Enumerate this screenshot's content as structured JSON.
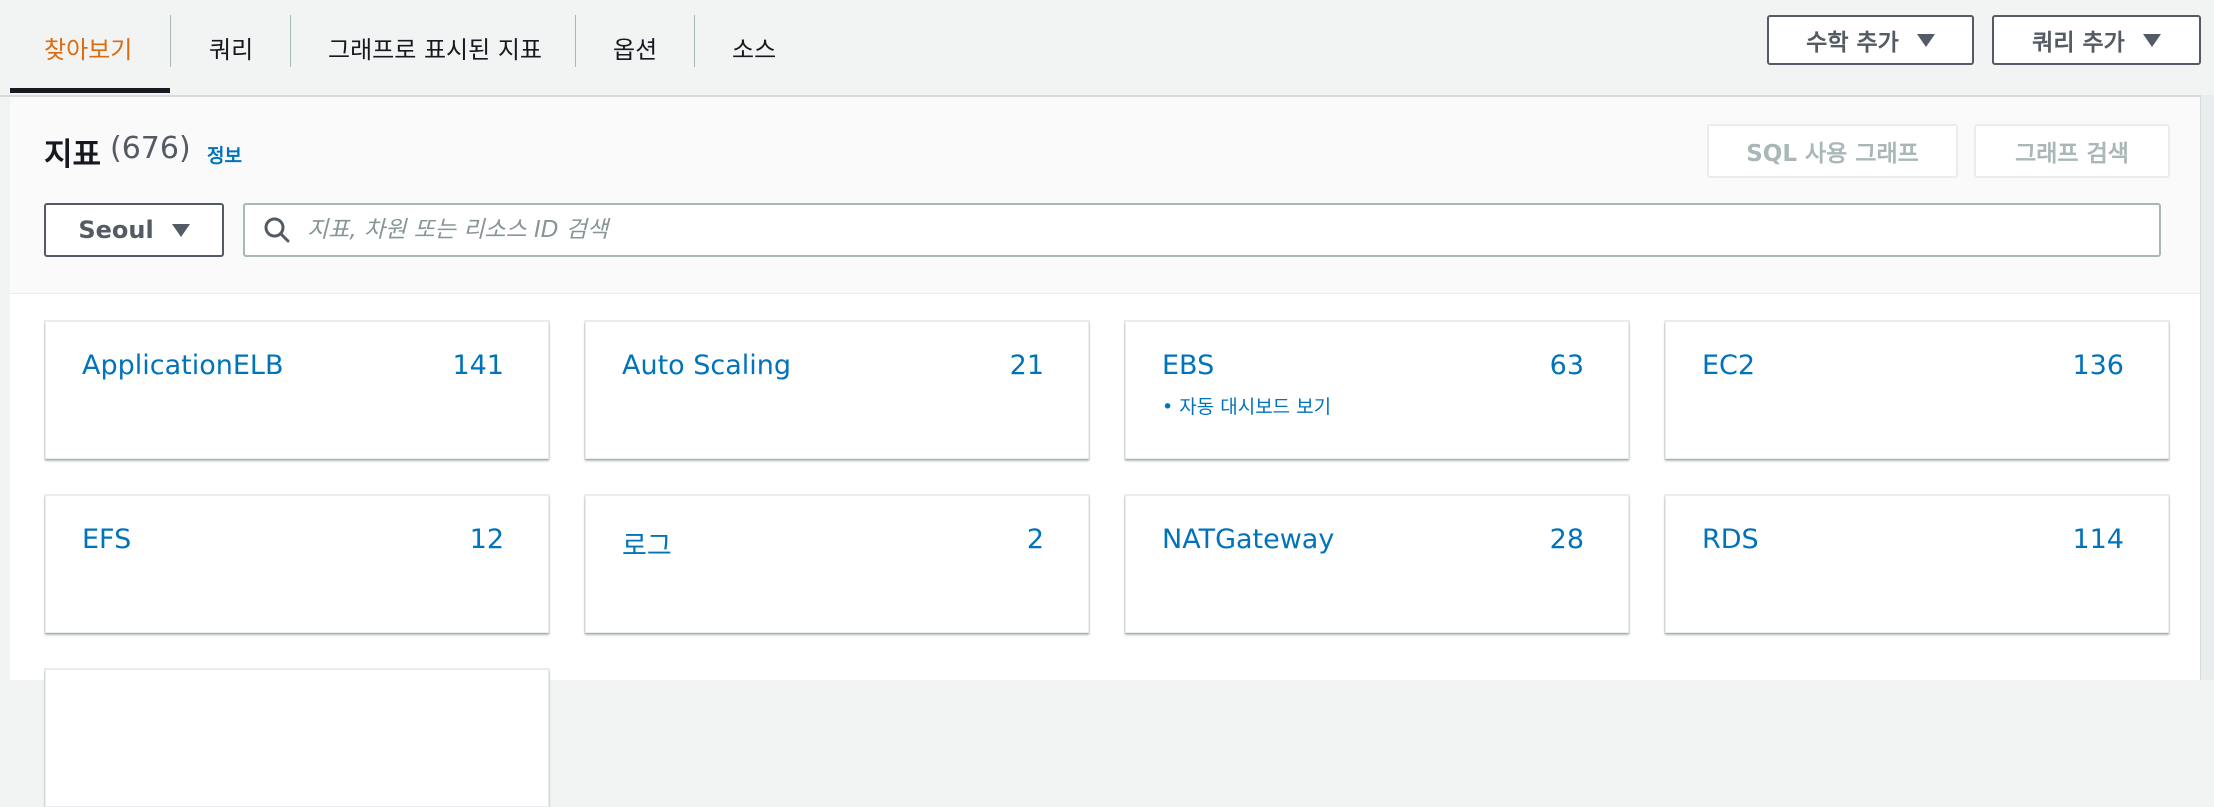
{
  "tabs": [
    {
      "label": "찾아보기",
      "active": true
    },
    {
      "label": "쿼리",
      "active": false
    },
    {
      "label": "그래프로 표시된 지표",
      "active": false
    },
    {
      "label": "옵션",
      "active": false
    },
    {
      "label": "소스",
      "active": false
    }
  ],
  "top_buttons": {
    "math_label": "수학 추가",
    "query_label": "쿼리 추가"
  },
  "panel": {
    "title": "지표",
    "count": "(676)",
    "info_link": "정보",
    "sql_graph_button": "SQL 사용 그래프",
    "graph_search_button": "그래프 검색",
    "region": "Seoul",
    "search_placeholder": "지표, 차원 또는 리소스 ID 검색"
  },
  "namespaces": [
    {
      "name": "ApplicationELB",
      "count": "141"
    },
    {
      "name": "Auto Scaling",
      "count": "21"
    },
    {
      "name": "EBS",
      "count": "63",
      "sub": "• 자동 대시보드 보기"
    },
    {
      "name": "EC2",
      "count": "136"
    },
    {
      "name": "EFS",
      "count": "12"
    },
    {
      "name": "로그",
      "count": "2"
    },
    {
      "name": "NATGateway",
      "count": "28"
    },
    {
      "name": "RDS",
      "count": "114"
    }
  ],
  "colors": {
    "accent_orange": "#dd6b10",
    "link_blue": "#0073bb",
    "text_dark": "#16191f",
    "text_gray": "#545b64"
  }
}
